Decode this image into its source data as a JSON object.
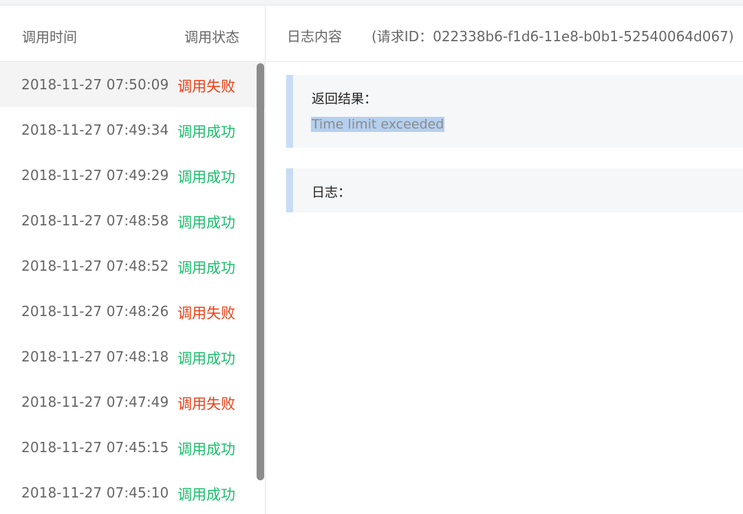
{
  "list": {
    "header": {
      "time_label": "调用时间",
      "status_label": "调用状态"
    },
    "rows": [
      {
        "time": "2018-11-27 07:50:09",
        "status": "调用失败",
        "ok": false
      },
      {
        "time": "2018-11-27 07:49:34",
        "status": "调用成功",
        "ok": true
      },
      {
        "time": "2018-11-27 07:49:29",
        "status": "调用成功",
        "ok": true
      },
      {
        "time": "2018-11-27 07:48:58",
        "status": "调用成功",
        "ok": true
      },
      {
        "time": "2018-11-27 07:48:52",
        "status": "调用成功",
        "ok": true
      },
      {
        "time": "2018-11-27 07:48:26",
        "status": "调用失败",
        "ok": false
      },
      {
        "time": "2018-11-27 07:48:18",
        "status": "调用成功",
        "ok": true
      },
      {
        "time": "2018-11-27 07:47:49",
        "status": "调用失败",
        "ok": false
      },
      {
        "time": "2018-11-27 07:45:15",
        "status": "调用成功",
        "ok": true
      },
      {
        "time": "2018-11-27 07:45:10",
        "status": "调用成功",
        "ok": true
      }
    ]
  },
  "detail": {
    "title": "日志内容",
    "request_id_text": "(请求ID：022338b6-f1d6-11e8-b0b1-52540064d067)",
    "result_label": "返回结果：",
    "result_value": "Time limit exceeded",
    "log_label": "日志："
  },
  "colors": {
    "success": "#19be6b",
    "failure": "#ed3f14",
    "accent_bar": "#c7dcf5",
    "selection": "#b5d0ef"
  }
}
